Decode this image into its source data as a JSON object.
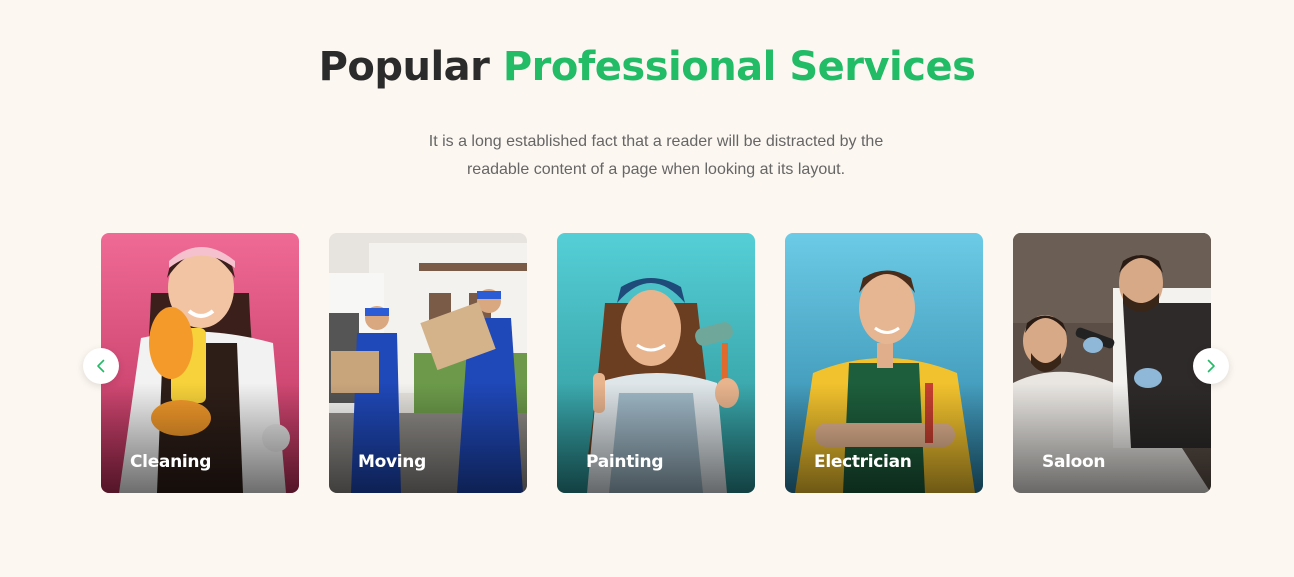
{
  "section": {
    "title_plain": "Popular",
    "title_accent": "Professional Services",
    "subtitle_line1": "It is a long established fact that a reader will be distracted by the",
    "subtitle_line2": "readable content of a page when looking at its layout."
  },
  "services": [
    {
      "label": "Cleaning"
    },
    {
      "label": "Moving"
    },
    {
      "label": "Painting"
    },
    {
      "label": "Electrician"
    },
    {
      "label": "Saloon"
    }
  ],
  "carousel": {
    "prev_icon": "chevron-left-icon",
    "next_icon": "chevron-right-icon"
  },
  "colors": {
    "background": "#fcf7f1",
    "accent": "#22bb66",
    "heading": "#2b2b2b",
    "text": "#666666"
  }
}
